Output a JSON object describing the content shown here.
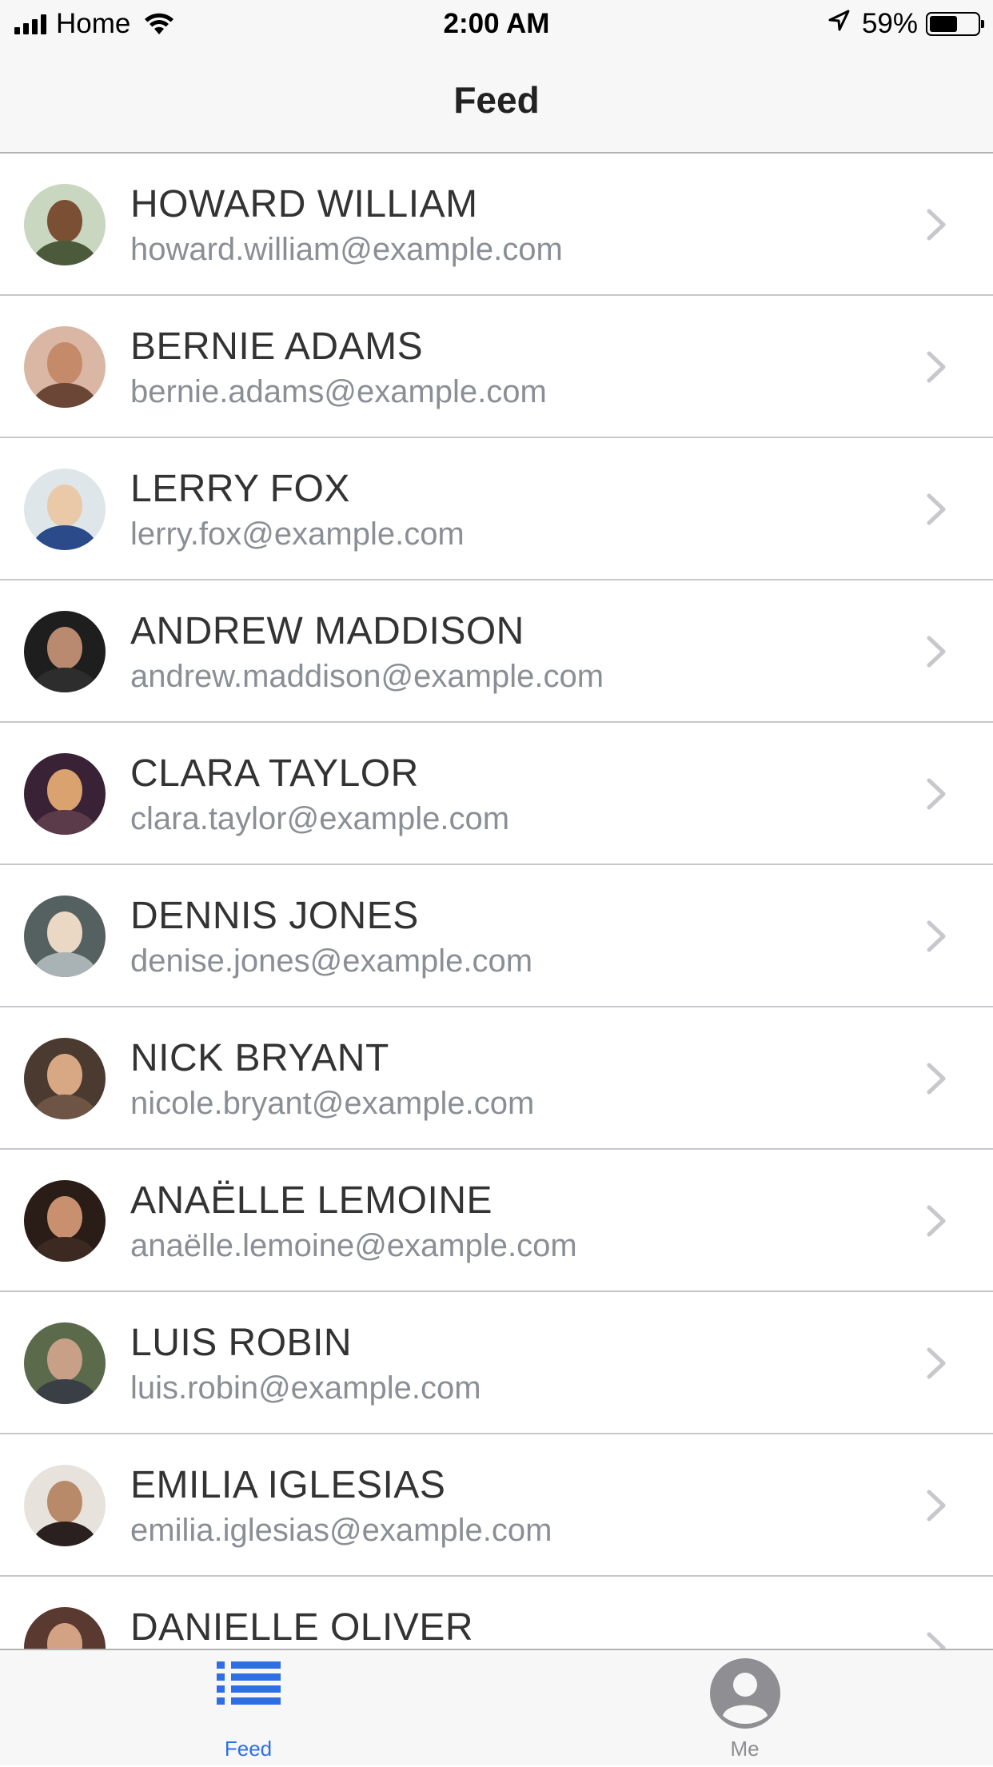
{
  "status_bar": {
    "carrier": "Home",
    "time": "2:00 AM",
    "battery_percent": "59%",
    "battery_level": 0.59
  },
  "nav": {
    "title": "Feed"
  },
  "contacts": [
    {
      "name": "HOWARD WILLIAM",
      "email": "howard.william@example.com"
    },
    {
      "name": "BERNIE ADAMS",
      "email": "bernie.adams@example.com"
    },
    {
      "name": "LERRY FOX",
      "email": "lerry.fox@example.com"
    },
    {
      "name": "ANDREW MADDISON",
      "email": "andrew.maddison@example.com"
    },
    {
      "name": "CLARA TAYLOR",
      "email": "clara.taylor@example.com"
    },
    {
      "name": "DENNIS JONES",
      "email": "denise.jones@example.com"
    },
    {
      "name": "NICK BRYANT",
      "email": "nicole.bryant@example.com"
    },
    {
      "name": "ANAËLLE LEMOINE",
      "email": "anaëlle.lemoine@example.com"
    },
    {
      "name": "LUIS ROBIN",
      "email": "luis.robin@example.com"
    },
    {
      "name": "EMILIA IGLESIAS",
      "email": "emilia.iglesias@example.com"
    },
    {
      "name": "DANIELLE OLIVER",
      "email": ""
    }
  ],
  "tabs": [
    {
      "label": "Feed",
      "icon": "list-icon",
      "active": true
    },
    {
      "label": "Me",
      "icon": "user-circle-icon",
      "active": false
    }
  ],
  "colors": {
    "accent": "#2f6fe4",
    "inactive": "#8e8e93",
    "chevron": "#c7c7cc"
  }
}
